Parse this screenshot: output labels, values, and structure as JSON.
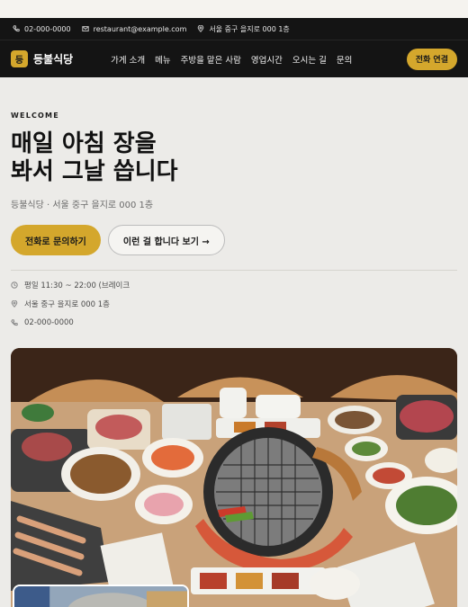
{
  "infobar": {
    "phone": "02-000-0000",
    "email": "restaurant@example.com",
    "address": "서울 중구 을지로 000 1층"
  },
  "nav": {
    "logo_glyph": "등",
    "brand_name": "등불식당",
    "menu": [
      "가게 소개",
      "메뉴",
      "주방을 맡은 사람",
      "영업시간",
      "오시는 길",
      "문의"
    ],
    "call_label": "전화 연결"
  },
  "hero": {
    "eyebrow": "WELCOME",
    "headline_line1": "매일 아침 장을",
    "headline_line2": "봐서 그날 씁니다",
    "subline": "등불식당 · 서울 중구 을지로 000 1층",
    "primary_cta": "전화로 문의하기",
    "secondary_cta": "이런 걸 합니다 보기 →",
    "details": {
      "hours": "평일 11:30 ~ 22:00 (브레이크",
      "address": "서울 중구 을지로 000 1층",
      "phone": "02-000-0000"
    }
  },
  "colors": {
    "accent": "#d4a72c",
    "dark": "#141414",
    "hero_bg": "#ecebe8"
  },
  "icons": {
    "phone": "phone-icon",
    "email": "mail-icon",
    "location": "pin-icon",
    "clock": "clock-icon"
  }
}
